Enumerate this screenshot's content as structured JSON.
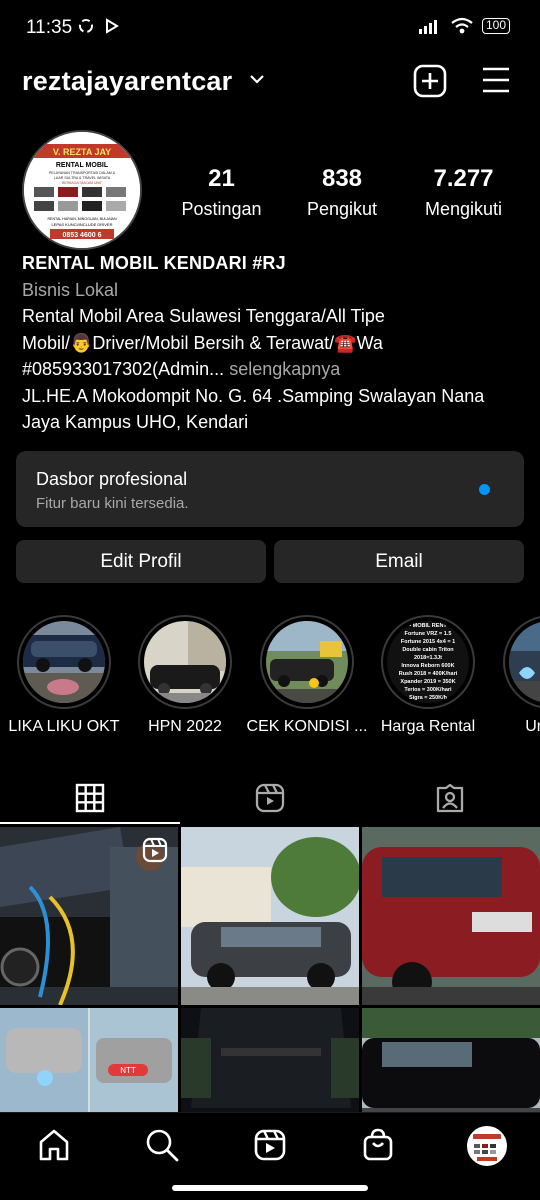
{
  "status_bar": {
    "time": "11:35",
    "battery": "100"
  },
  "header": {
    "username": "reztajayarentcar"
  },
  "stats": [
    {
      "number": "21",
      "label": "Postingan"
    },
    {
      "number": "838",
      "label": "Pengikut"
    },
    {
      "number": "7.277",
      "label": "Mengikuti"
    }
  ],
  "avatar_text": {
    "banner": "V. REZTA JAY",
    "title": "RENTAL MOBIL",
    "line1": "PELAYANAN TRANSPORTASI DALAM &",
    "line2": "LUAR SULTRA & TRAVEL WISATA",
    "line3": "BERBAGAI MACAM UNIT",
    "line4": "RENTAL HARIAN, MINGGUAN, BULANAN",
    "line5": "LEPAS KUNCI/INCLUDE DRIVER",
    "phone": "0853 4600 6"
  },
  "bio": {
    "name": "RENTAL MOBIL KENDARI #RJ",
    "category": "Bisnis Lokal",
    "line1": "Rental Mobil Area Sulawesi Tenggara/All Tipe",
    "line2": "Mobil/👨Driver/Mobil Bersih & Terawat/☎️Wa",
    "line3": "#085933017302(Admin...",
    "more": "selengkapnya",
    "address1": "JL.HE.A Mokodompit No. G. 64 .Samping Swalayan Nana",
    "address2": "Jaya Kampus UHO, Kendari"
  },
  "dashboard": {
    "title": "Dasbor profesional",
    "subtitle": "Fitur baru kini tersedia."
  },
  "buttons": {
    "edit": "Edit Profil",
    "email": "Email"
  },
  "highlights": [
    {
      "label": "LIKA LIKU OKT"
    },
    {
      "label": "HPN 2022"
    },
    {
      "label": "CEK KONDISI ..."
    },
    {
      "label": "Harga Rental"
    },
    {
      "label": "Unit Te"
    }
  ],
  "price_list": {
    "l1": "• MOBIL RENT",
    "l2": "Fortune VRZ = 1.5",
    "l3": "Fortune 2015 4x4 = 1",
    "l4": "Double cabin Triton",
    "l5": "2018=1.3Jt",
    "l6": "Innova Reborn 600K",
    "l7": "Rush 2018 = 400K/hari",
    "l8": "Xpander 2019 = 350K",
    "l9": "Terios = 300K/hari",
    "l10": "Sigra = 250K/h"
  },
  "grid_badge": {
    "plate": "NTT"
  },
  "colors": {
    "background": "#000000",
    "surface": "#262626",
    "accent": "#0095f6",
    "muted": "#a8a8a8"
  }
}
